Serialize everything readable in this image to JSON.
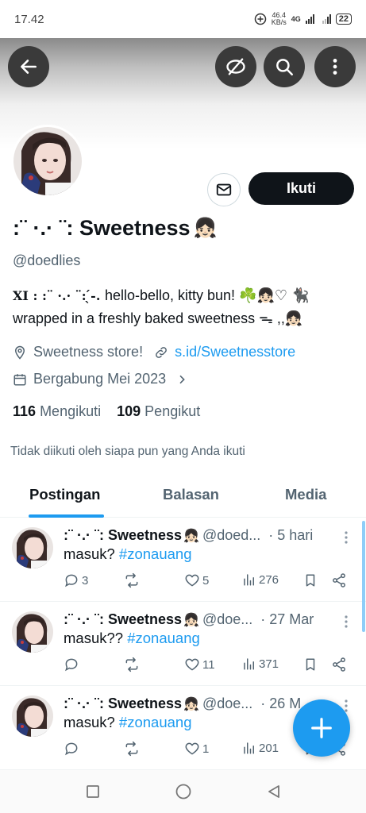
{
  "status": {
    "time": "17.42",
    "speed_value": "46.4",
    "speed_unit": "KB/s",
    "network": "4G",
    "battery": "22"
  },
  "profile": {
    "name": ":¨ ·.· ¨: Sweetness",
    "name_emoji": "👧🏻",
    "handle": "@doedlies",
    "bio_prefix": "XI : :¨ ·.· ¨:  ̖́-. ",
    "bio_line1": "hello-bello, kitty bun!  ☘️👧🏻♡ 🐈‍⬛",
    "bio_line2": "wrapped in a freshly baked sweetness ᯓ ,,👧🏻",
    "location": "Sweetness store!",
    "link": "s.id/Sweetnesstore",
    "joined": "Bergabung Mei 2023",
    "following_count": "116",
    "following_label": "Mengikuti",
    "followers_count": "109",
    "followers_label": "Pengikut",
    "not_followed": "Tidak diikuti oleh siapa pun yang Anda ikuti",
    "follow_label": "Ikuti"
  },
  "tabs": [
    "Postingan",
    "Balasan",
    "Media"
  ],
  "posts": [
    {
      "name": ":¨ ·.· ¨: Sweetness",
      "emoji": "👧🏻",
      "handle": "@doed...",
      "time": "· 5 hari",
      "text": "masuk?",
      "hashtag": "#zonauang",
      "replies": "3",
      "retweets": "",
      "likes": "5",
      "views": "276"
    },
    {
      "name": ":¨ ·.· ¨: Sweetness",
      "emoji": "👧🏻",
      "handle": "@doe...",
      "time": "· 27 Mar",
      "text": "masuk??",
      "hashtag": "#zonauang",
      "replies": "",
      "retweets": "",
      "likes": "11",
      "views": "371"
    },
    {
      "name": ":¨ ·.· ¨: Sweetness",
      "emoji": "👧🏻",
      "handle": "@doe...",
      "time": "· 26 M",
      "text": "masuk?",
      "hashtag": "#zonauang",
      "replies": "",
      "retweets": "",
      "likes": "1",
      "views": "201"
    }
  ],
  "colors": {
    "accent": "#1d9bf0",
    "text": "#0f1419",
    "muted": "#536471"
  },
  "icons": {
    "back": "arrow-left-icon",
    "hide": "eye-slash-icon",
    "search": "search-icon",
    "more": "more-vertical-icon",
    "message": "envelope-icon",
    "location": "location-pin-icon",
    "link": "link-icon",
    "calendar": "calendar-icon",
    "compose": "plus-icon"
  }
}
